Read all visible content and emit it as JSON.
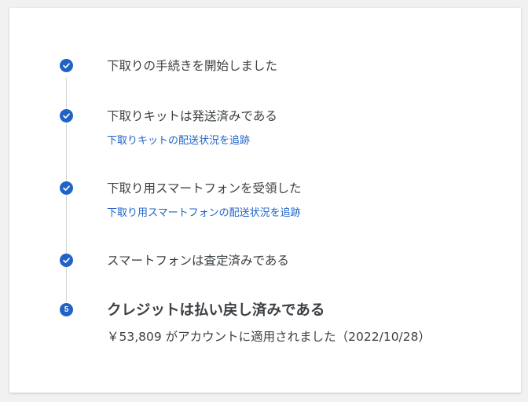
{
  "steps": [
    {
      "label": "下取りの手続きを開始しました",
      "status": "completed",
      "icon": "check-icon"
    },
    {
      "label": "下取りキットは発送済みである",
      "status": "completed",
      "icon": "check-icon",
      "link": "下取りキットの配送状況を追跡"
    },
    {
      "label": "下取り用スマートフォンを受領した",
      "status": "completed",
      "icon": "check-icon",
      "link": "下取り用スマートフォンの配送状況を追跡"
    },
    {
      "label": "スマートフォンは査定済みである",
      "status": "completed",
      "icon": "check-icon"
    },
    {
      "label": "クレジットは払い戻し済みである",
      "status": "current",
      "number": "5",
      "detail": "￥53,809 がアカウントに適用されました（2022/10/28）"
    }
  ],
  "colors": {
    "accent": "#1f63c6",
    "connector": "#d6d6d6",
    "text": "#3c4043"
  }
}
